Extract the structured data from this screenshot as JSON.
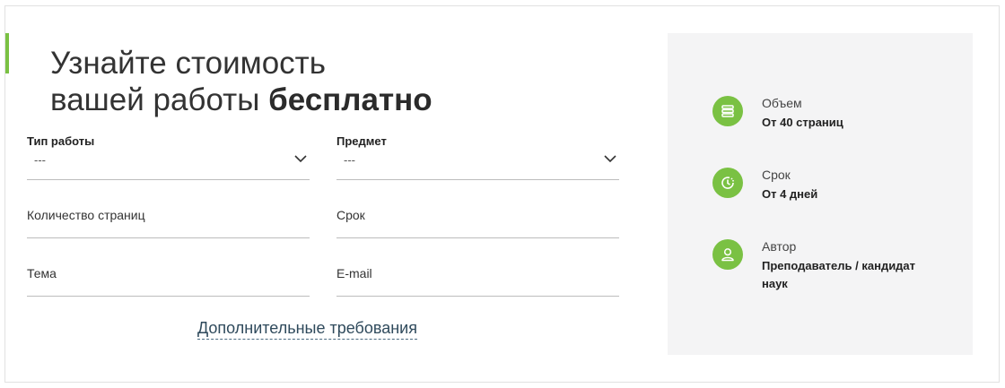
{
  "heading": {
    "line1": "Узнайте стоимость",
    "line2_regular": "вашей работы ",
    "line2_bold": "бесплатно"
  },
  "form": {
    "work_type": {
      "label": "Тип работы",
      "value": "---"
    },
    "subject": {
      "label": "Предмет",
      "value": "---"
    },
    "pages": {
      "label": "Количество страниц"
    },
    "deadline": {
      "label": "Срок"
    },
    "topic": {
      "label": "Тема"
    },
    "email": {
      "label": "E-mail"
    },
    "extra_link": "Дополнительные требования"
  },
  "info": {
    "items": [
      {
        "title": "Объем",
        "value": "От 40 страниц",
        "icon": "stack-icon"
      },
      {
        "title": "Срок",
        "value": "От 4 дней",
        "icon": "clock-icon"
      },
      {
        "title": "Автор",
        "value": "Преподаватель / кандидат наук",
        "icon": "user-icon"
      }
    ]
  },
  "colors": {
    "accent": "#7ac143",
    "panel_bg": "#f4f4f5",
    "link": "#2f4a5c"
  }
}
